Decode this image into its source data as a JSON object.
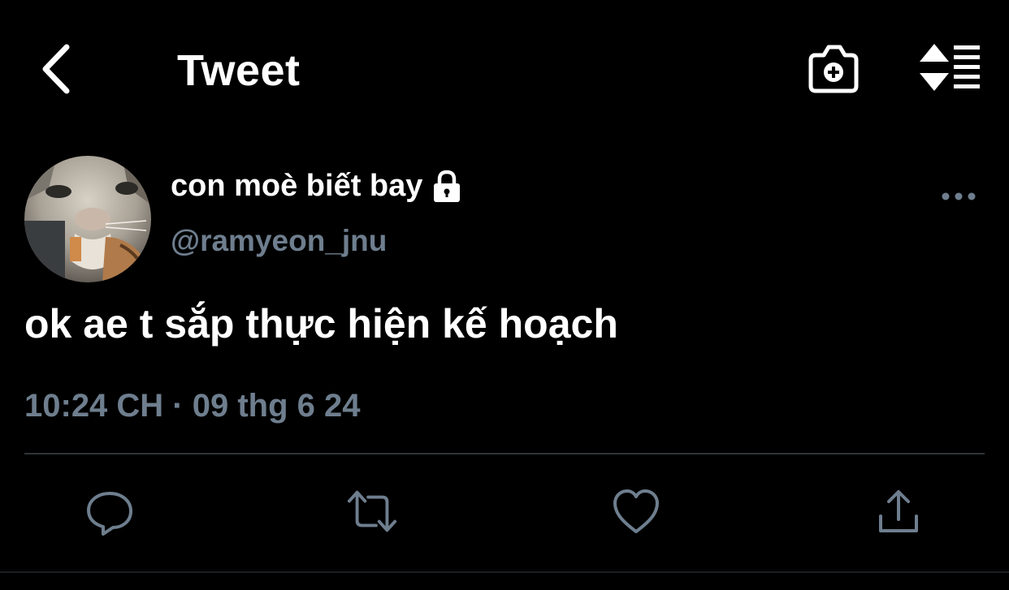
{
  "header": {
    "title": "Tweet",
    "back_icon": "chevron-left-icon",
    "camera_icon": "camera-add-icon",
    "sort_icon": "sort-list-icon"
  },
  "tweet": {
    "display_name": "con moè biết bay",
    "protected_icon": "lock-icon",
    "handle": "@ramyeon_jnu",
    "more_icon": "more-horizontal-icon",
    "text": "ok ae t sắp thực hiện kế hoạch",
    "timestamp": "10:24 CH · 09 thg 6 24"
  },
  "actions": {
    "reply_icon": "reply-icon",
    "retweet_icon": "retweet-icon",
    "like_icon": "heart-icon",
    "share_icon": "share-icon"
  },
  "colors": {
    "background": "#000000",
    "primary_text": "#ffffff",
    "secondary_text": "#6e7e8e",
    "divider": "#2f3336"
  }
}
